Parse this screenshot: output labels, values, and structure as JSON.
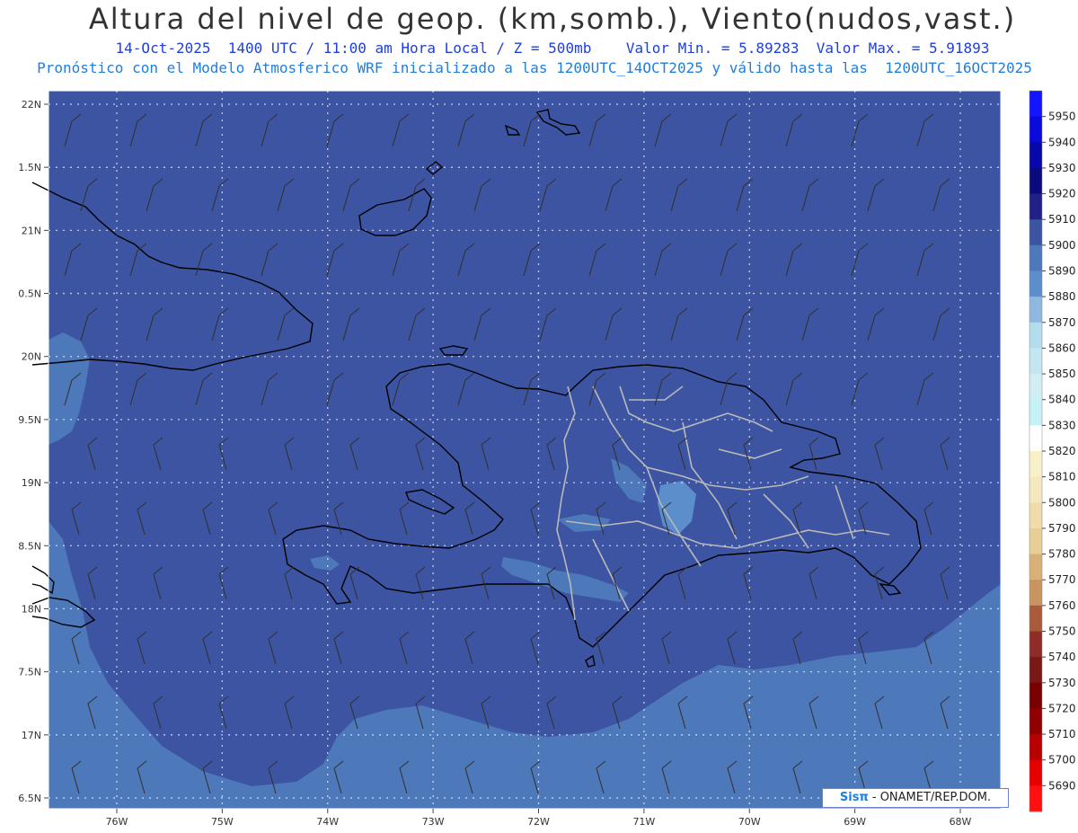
{
  "header": {
    "title": "Altura del nivel de geop. (km,somb.), Viento(nudos,vast.)",
    "subtitle": "14-Oct-2025  1400 UTC / 11:00 am Hora Local / Z = 500mb    Valor Min. = 5.89283  Valor Max. = 5.91893",
    "model_line": "Pronóstico con el Modelo Atmosferico WRF inicializado a las 1200UTC_14OCT2025 y válido hasta las  1200UTC_16OCT2025"
  },
  "map": {
    "lat_labels": [
      "22N",
      "1.5N",
      "21N",
      "0.5N",
      "20N",
      "9.5N",
      "19N",
      "8.5N",
      "18N",
      "7.5N",
      "17N",
      "6.5N"
    ],
    "lon_labels": [
      "76W",
      "75W",
      "74W",
      "73W",
      "72W",
      "71W",
      "70W",
      "69W",
      "68W"
    ],
    "lat_values": [
      22,
      21.5,
      21,
      20.5,
      20,
      19.5,
      19,
      18.5,
      18,
      17.5,
      17,
      16.5
    ],
    "lon_values": [
      76,
      75,
      74,
      73,
      72,
      71,
      70,
      69,
      68
    ],
    "colors": {
      "field_5900": "#3c54a2",
      "field_5890": "#4d79bb",
      "field_5880": "#5b8ecb",
      "coast": "#000000",
      "borders": "#b9b9b9",
      "grid": "#ffffff"
    }
  },
  "colorbar": {
    "labels": [
      "5950",
      "5940",
      "5930",
      "5920",
      "5910",
      "5900",
      "5890",
      "5880",
      "5870",
      "5860",
      "5850",
      "5840",
      "5830",
      "5820",
      "5810",
      "5800",
      "5790",
      "5780",
      "5770",
      "5760",
      "5750",
      "5740",
      "5730",
      "5720",
      "5710",
      "5700",
      "5690"
    ],
    "colors": [
      "#1414ff",
      "#0a0adc",
      "#0808a8",
      "#0a0a7a",
      "#202088",
      "#3c54a2",
      "#4d79bb",
      "#5b8ecb",
      "#8fb8e0",
      "#b3dcec",
      "#c4e6f0",
      "#d2eef5",
      "#c5f2f6",
      "#ffffff",
      "#f8f0c8",
      "#f5e8c0",
      "#f0dcaa",
      "#e8cd96",
      "#d8b078",
      "#c89460",
      "#a85c3c",
      "#902c28",
      "#7a1818",
      "#7a0000",
      "#900000",
      "#b80000",
      "#e60000",
      "#ff1010"
    ]
  },
  "badge": {
    "sis": "Sisπ",
    "text": "- ONAMET/REP.DOM."
  }
}
